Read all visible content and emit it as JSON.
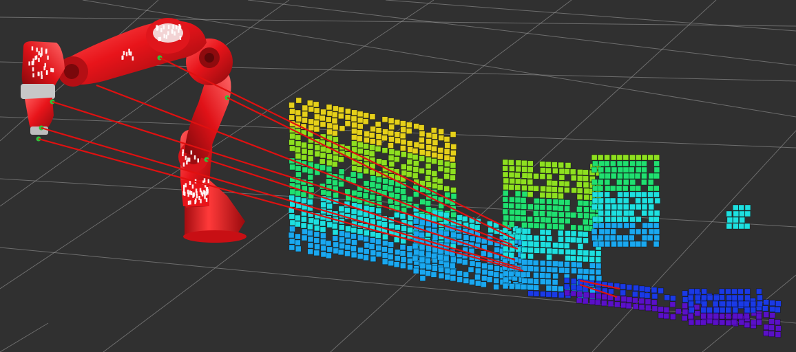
{
  "viewport": {
    "background": "#303030",
    "grid_color": "#a0a0a0"
  },
  "robot_arm": {
    "color": "#e8141a",
    "highlight": "#ff6a6a",
    "shadow": "#8c0a0d",
    "marker_color": "#ffffff",
    "joint_dot_color": "#2ec43a"
  },
  "distance_rays": {
    "color": "#e01010",
    "count": 9
  },
  "voxel_cloud": {
    "colormap": "height-rainbow",
    "colormap_stops": [
      "#5a10c8",
      "#1a3ae6",
      "#1aa8f0",
      "#1ee0e0",
      "#20e070",
      "#8ee020",
      "#e6d01a",
      "#f0a020"
    ],
    "edge_color": "#000000"
  }
}
